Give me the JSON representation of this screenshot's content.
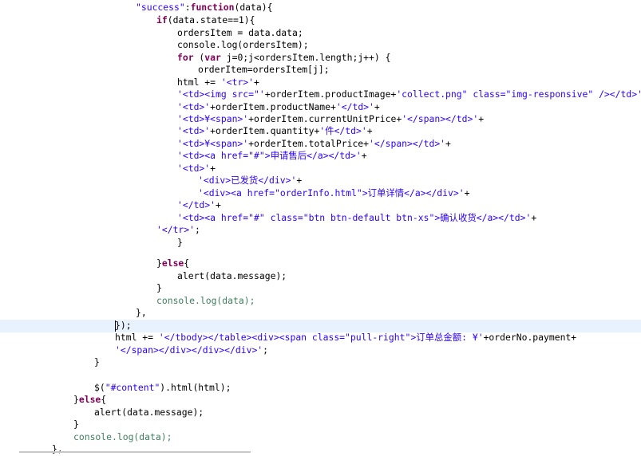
{
  "editor": {
    "language": "javascript",
    "current_line_index": 26,
    "token_colors": {
      "keyword": "#7f0055",
      "string": "#2a00ff",
      "green": "#3f7f5f",
      "plain": "#000000",
      "current_line_bg": "#e8f2fe"
    },
    "lines": [
      [
        [
          "\"success\"",
          "s"
        ],
        [
          ":",
          "p"
        ],
        [
          "function",
          "k"
        ],
        [
          "(data){",
          "p"
        ]
      ],
      [
        [
          "if",
          "k"
        ],
        [
          "(data.state==1){",
          "p"
        ]
      ],
      [
        [
          "ordersItem = data.data;",
          "p"
        ]
      ],
      [
        [
          "console.log(ordersItem);",
          "p"
        ]
      ],
      [
        [
          "for",
          "k"
        ],
        [
          " (",
          "p"
        ],
        [
          "var",
          "k"
        ],
        [
          " j=0;j<ordersItem.length;j++) {",
          "p"
        ]
      ],
      [
        [
          "orderItem=ordersItem[j];",
          "p"
        ]
      ],
      [
        [
          "html += ",
          "p"
        ],
        [
          "'<tr>'",
          "s"
        ],
        [
          "+",
          "p"
        ]
      ],
      [
        [
          "'<td><img src=\"'",
          "s"
        ],
        [
          "+orderItem.productImage+",
          "p"
        ],
        [
          "'collect.png\" class=\"img-responsive\" /></td>'",
          "s"
        ],
        [
          "+",
          "p"
        ]
      ],
      [
        [
          "'<td>'",
          "s"
        ],
        [
          "+orderItem.productName+",
          "p"
        ],
        [
          "'</td>'",
          "s"
        ],
        [
          "+",
          "p"
        ]
      ],
      [
        [
          "'<td>¥<span>'",
          "s"
        ],
        [
          "+orderItem.currentUnitPrice+",
          "p"
        ],
        [
          "'</span></td>'",
          "s"
        ],
        [
          "+",
          "p"
        ]
      ],
      [
        [
          "'<td>'",
          "s"
        ],
        [
          "+orderItem.quantity+",
          "p"
        ],
        [
          "'件</td>'",
          "s"
        ],
        [
          "+",
          "p"
        ]
      ],
      [
        [
          "'<td>¥<span>'",
          "s"
        ],
        [
          "+orderItem.totalPrice+",
          "p"
        ],
        [
          "'</span></td>'",
          "s"
        ],
        [
          "+",
          "p"
        ]
      ],
      [
        [
          "'<td><a href=\"#\">申请售后</a></td>'",
          "s"
        ],
        [
          "+",
          "p"
        ]
      ],
      [
        [
          "'<td>'",
          "s"
        ],
        [
          "+",
          "p"
        ]
      ],
      [
        [
          "'<div>已发货</div>'",
          "s"
        ],
        [
          "+",
          "p"
        ]
      ],
      [
        [
          "'<div><a href=\"orderInfo.html\">订单详情</a></div>'",
          "s"
        ],
        [
          "+",
          "p"
        ]
      ],
      [
        [
          "'</td>'",
          "s"
        ],
        [
          "+",
          "p"
        ]
      ],
      [
        [
          "'<td><a href=\"#\" class=\"btn btn-default btn-xs\">确认收货</a></td>'",
          "s"
        ],
        [
          "+",
          "p"
        ]
      ],
      [
        [
          "'</tr>'",
          "s"
        ],
        [
          ";",
          "p"
        ]
      ],
      [
        [
          "}",
          "p"
        ]
      ],
      [
        [
          "",
          "p"
        ]
      ],
      [
        [
          "}",
          "p"
        ],
        [
          "else",
          "k"
        ],
        [
          "{",
          "p"
        ]
      ],
      [
        [
          "alert(data.message);",
          "p"
        ]
      ],
      [
        [
          "}",
          "p"
        ]
      ],
      [
        [
          "console.log(data);",
          "g"
        ]
      ],
      [
        [
          "},",
          "p"
        ]
      ],
      [
        [
          "});",
          "p"
        ]
      ],
      [
        [
          "html += ",
          "p"
        ],
        [
          "'</tbody></table><div><span class=\"pull-right\">订单总金额: ¥'",
          "s"
        ],
        [
          "+orderNo.payment+",
          "p"
        ]
      ],
      [
        [
          "'</span></div></div></div>'",
          "s"
        ],
        [
          ";",
          "p"
        ]
      ],
      [
        [
          "}",
          "p"
        ]
      ],
      [
        [
          "",
          "p"
        ]
      ],
      [
        [
          "$(",
          "p"
        ],
        [
          "\"#content\"",
          "s"
        ],
        [
          ").html(html);",
          "p"
        ]
      ],
      [
        [
          "}",
          "p"
        ],
        [
          "else",
          "k"
        ],
        [
          "{",
          "p"
        ]
      ],
      [
        [
          "alert(data.message);",
          "p"
        ]
      ],
      [
        [
          "}",
          "p"
        ]
      ],
      [
        [
          "console.log(data);",
          "g"
        ]
      ],
      [
        [
          "},",
          "p"
        ]
      ],
      [
        [
          "});",
          "p"
        ]
      ],
      [
        [
          "",
          "p"
        ]
      ],
      [
        [
          "}",
          "p"
        ]
      ]
    ]
  }
}
